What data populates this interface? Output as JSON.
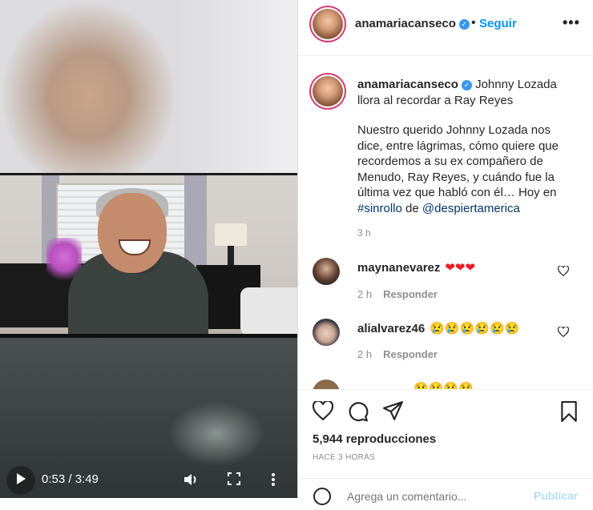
{
  "video": {
    "time": "0:53 / 3:49",
    "icons": {
      "play": "play-icon",
      "volume": "volume-icon",
      "fullscreen": "fullscreen-icon",
      "more": "more-vertical-icon"
    }
  },
  "header": {
    "username": "anamariacanseco",
    "dot": "•",
    "follow_label": "Seguir",
    "menu": "•••"
  },
  "caption": {
    "username": "anamariacanseco",
    "title_line": "Johnny Lozada llora al recordar a Ray Reyes",
    "body": "Nuestro querido Johnny Lozada nos dice, entre lágrimas, cómo quiere que recordemos a su ex compañero de Menudo, Ray Reyes, y cuándo fue la última vez que habló con él… Hoy en ",
    "hashtag": "#sinrollo",
    "de": " de ",
    "mention": "@despiertamerica",
    "time": "3 h"
  },
  "comments": [
    {
      "username": "maynanevarez",
      "text": "❤❤❤",
      "time": "2 h",
      "reply": "Responder"
    },
    {
      "username": "alialvarez46",
      "text": "😢😢😢😢😢😢",
      "time": "2 h",
      "reply": "Responder"
    },
    {
      "username": "",
      "text": "😢😢😢😢"
    }
  ],
  "actions": {
    "views": "5,944 reproducciones",
    "ago": "HACE 3 HORAS",
    "icons": {
      "like": "heart-outline-icon",
      "comment": "comment-icon",
      "share": "send-icon",
      "save": "bookmark-icon"
    }
  },
  "add_comment": {
    "placeholder": "Agrega un comentario...",
    "publish": "Publicar"
  },
  "colors": {
    "link": "#00376b",
    "follow": "#0095f6",
    "ring": "#d63c6f",
    "verified": "#3897f0"
  }
}
